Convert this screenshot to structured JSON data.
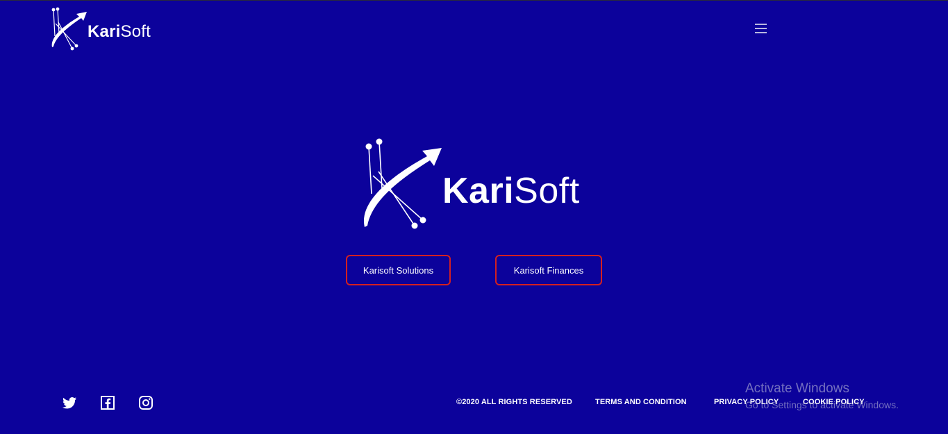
{
  "header": {
    "logo": {
      "brand_bold": "Kari",
      "brand_light": "Soft"
    },
    "menu_icon": "hamburger-menu-icon"
  },
  "hero": {
    "logo": {
      "brand_bold": "Kari",
      "brand_light": "Soft"
    },
    "buttons": [
      {
        "label": "Karisoft Solutions"
      },
      {
        "label": "Karisoft Finances"
      }
    ]
  },
  "footer": {
    "social": [
      {
        "icon": "twitter-icon"
      },
      {
        "icon": "facebook-icon"
      },
      {
        "icon": "instagram-icon"
      }
    ],
    "copyright": "©2020 ALL RIGHTS RESERVED",
    "links": [
      {
        "label": "TERMS AND CONDITION"
      },
      {
        "label": "PRIVACY POLICY"
      },
      {
        "label": "COOKIE POLICY"
      }
    ]
  },
  "os_watermark": {
    "title": "Activate Windows",
    "subtitle": "Go to Settings to activate Windows."
  },
  "colors": {
    "background": "#0c029b",
    "button_border": "#d42020",
    "text": "#ffffff",
    "menu_icon": "#b9b6e0"
  }
}
